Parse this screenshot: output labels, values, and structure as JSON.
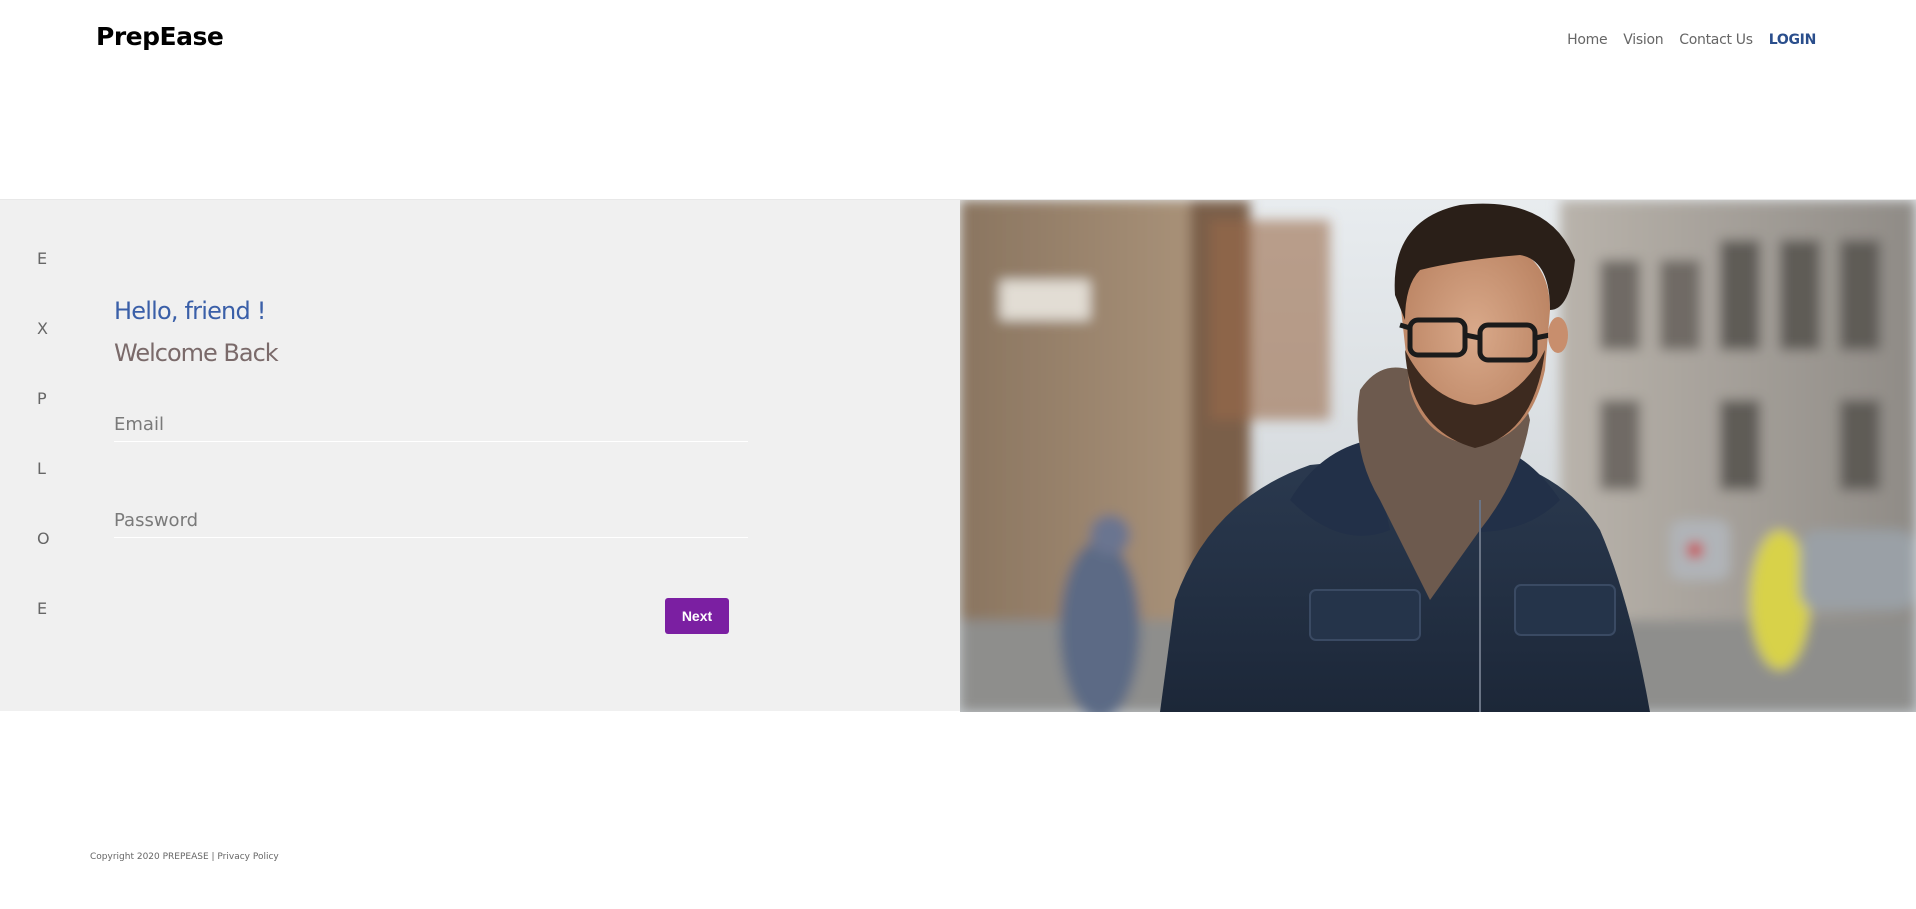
{
  "header": {
    "brand": "PrepEase",
    "nav": [
      {
        "label": "Home",
        "active": false
      },
      {
        "label": "Vision",
        "active": false
      },
      {
        "label": "Contact Us",
        "active": false
      },
      {
        "label": "LOGIN",
        "active": true
      }
    ]
  },
  "sidebar": {
    "letters": [
      "E",
      "X",
      "P",
      "L",
      "O",
      "E"
    ]
  },
  "login": {
    "greeting": "Hello, friend !",
    "title": "Welcome Back",
    "email_placeholder": "Email",
    "email_value": "",
    "password_placeholder": "Password",
    "password_value": "",
    "next_label": "Next"
  },
  "footer": {
    "copyright": "Copyright 2020 PREPEASE | ",
    "privacy_label": "Privacy Policy"
  },
  "colors": {
    "accent": "#7b1fa2",
    "greeting": "#3a5fa8",
    "nav_active": "#2a4e8c",
    "band_bg": "#f0f0f0"
  },
  "icons": {
    "hero": "man-with-glasses-photo"
  }
}
